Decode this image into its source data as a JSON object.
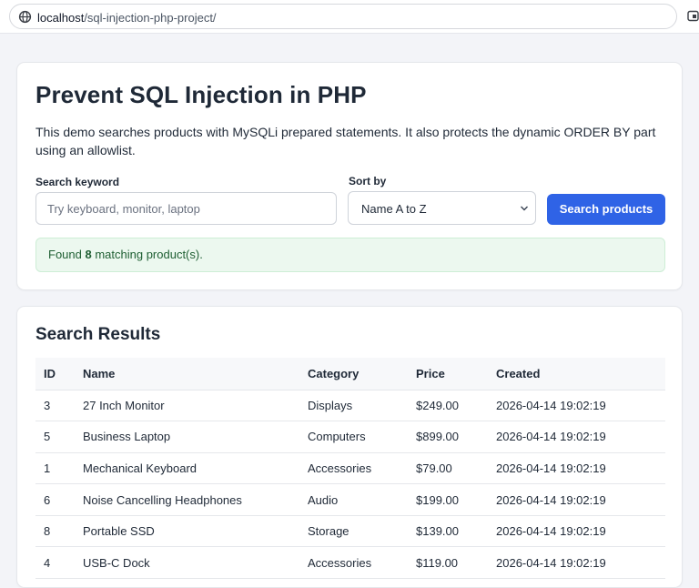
{
  "browser": {
    "url_host": "localhost",
    "url_path": "/sql-injection-php-project/"
  },
  "page": {
    "title": "Prevent SQL Injection in PHP",
    "intro": "This demo searches products with MySQLi prepared statements. It also protects the dynamic ORDER BY part using an allowlist."
  },
  "search_form": {
    "keyword_label": "Search keyword",
    "keyword_value": "",
    "keyword_placeholder": "Try keyboard, monitor, laptop",
    "sort_label": "Sort by",
    "sort_selected": "Name A to Z",
    "submit_label": "Search products"
  },
  "status": {
    "prefix": "Found ",
    "count": "8",
    "suffix": " matching product(s)."
  },
  "results": {
    "title": "Search Results",
    "columns": [
      "ID",
      "Name",
      "Category",
      "Price",
      "Created"
    ],
    "rows": [
      [
        "3",
        "27 Inch Monitor",
        "Displays",
        "$249.00",
        "2026-04-14 19:02:19"
      ],
      [
        "5",
        "Business Laptop",
        "Computers",
        "$899.00",
        "2026-04-14 19:02:19"
      ],
      [
        "1",
        "Mechanical Keyboard",
        "Accessories",
        "$79.00",
        "2026-04-14 19:02:19"
      ],
      [
        "6",
        "Noise Cancelling Headphones",
        "Audio",
        "$199.00",
        "2026-04-14 19:02:19"
      ],
      [
        "8",
        "Portable SSD",
        "Storage",
        "$139.00",
        "2026-04-14 19:02:19"
      ],
      [
        "4",
        "USB-C Dock",
        "Accessories",
        "$119.00",
        "2026-04-14 19:02:19"
      ]
    ]
  },
  "icons": {
    "site_info": "globe-icon",
    "tab_action": "open-tab-icon",
    "sort_dropdown": "chevron-down-icon"
  },
  "colors": {
    "primary_button": "#2f63e6",
    "success_bg": "#ecf8ef",
    "success_text": "#1f5f33"
  }
}
